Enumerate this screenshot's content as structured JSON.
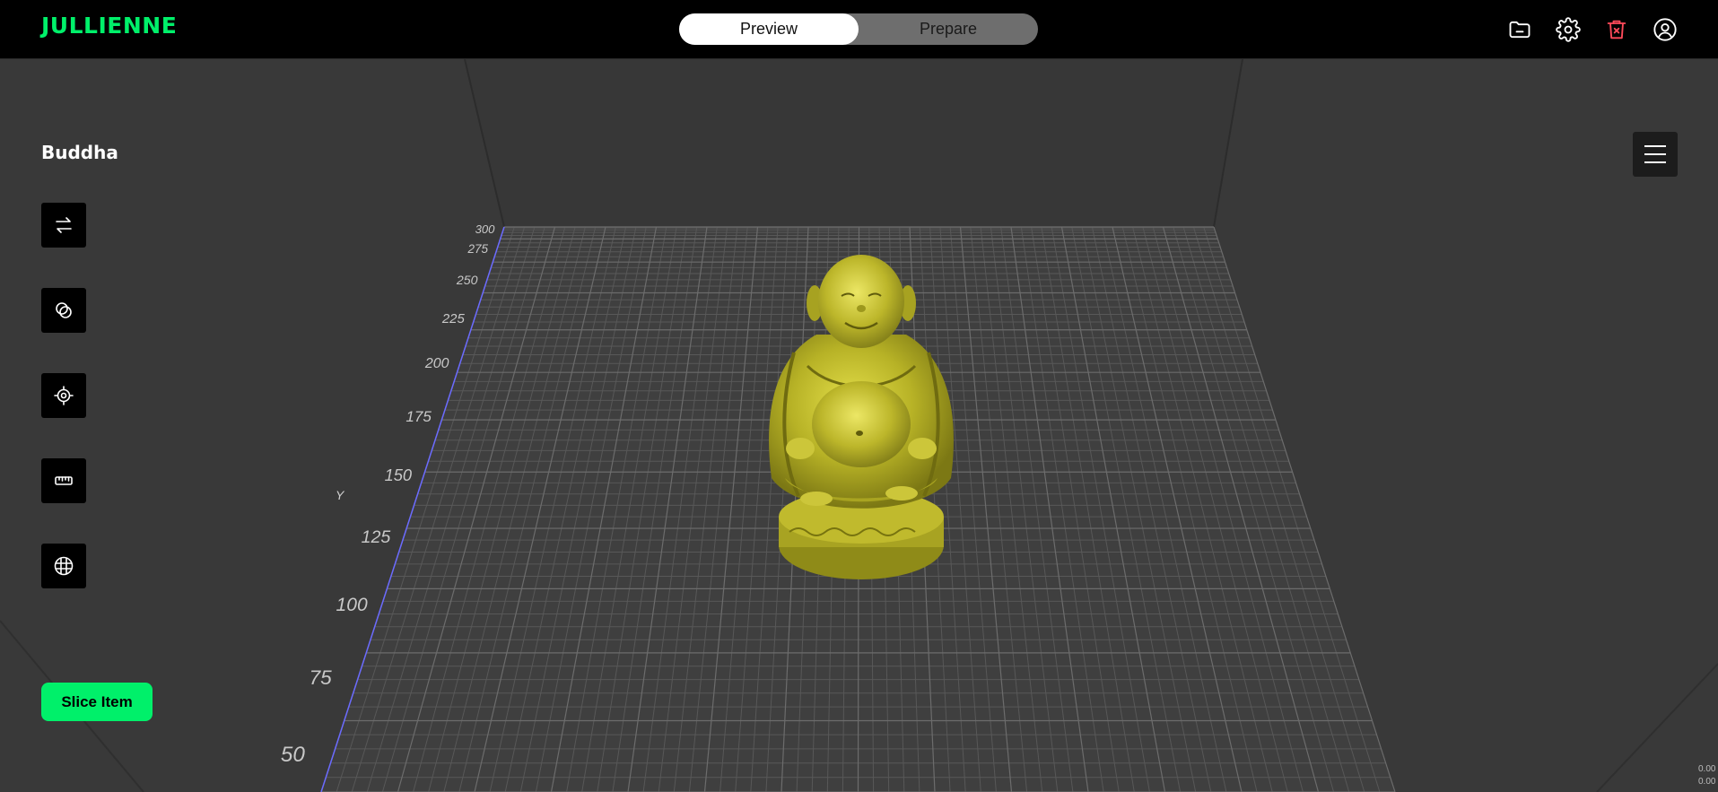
{
  "app": {
    "brand": "JULLIENNE"
  },
  "modes": {
    "preview": "Preview",
    "prepare": "Prepare",
    "active": "Preview"
  },
  "header_icons": [
    "folder-icon",
    "gear-icon",
    "trash-icon",
    "user-icon"
  ],
  "colors": {
    "accent": "#00f06a",
    "model": "#b7b226",
    "grid_line": "#5a5a5a",
    "y_axis": "#6b6bff",
    "delete_icon": "#ff4a5a"
  },
  "model": {
    "name": "Buddha"
  },
  "tools": [
    {
      "name": "move-icon"
    },
    {
      "name": "scale-icon"
    },
    {
      "name": "position-icon"
    },
    {
      "name": "ruler-icon"
    },
    {
      "name": "grid-icon"
    }
  ],
  "actions": {
    "slice_label": "Slice Item"
  },
  "axis": {
    "label": "Y",
    "ticks": [
      "300",
      "275",
      "250",
      "225",
      "200",
      "175",
      "150",
      "125",
      "100",
      "75",
      "50"
    ]
  },
  "readout": {
    "line1": "0.00",
    "line2": "0.00"
  }
}
